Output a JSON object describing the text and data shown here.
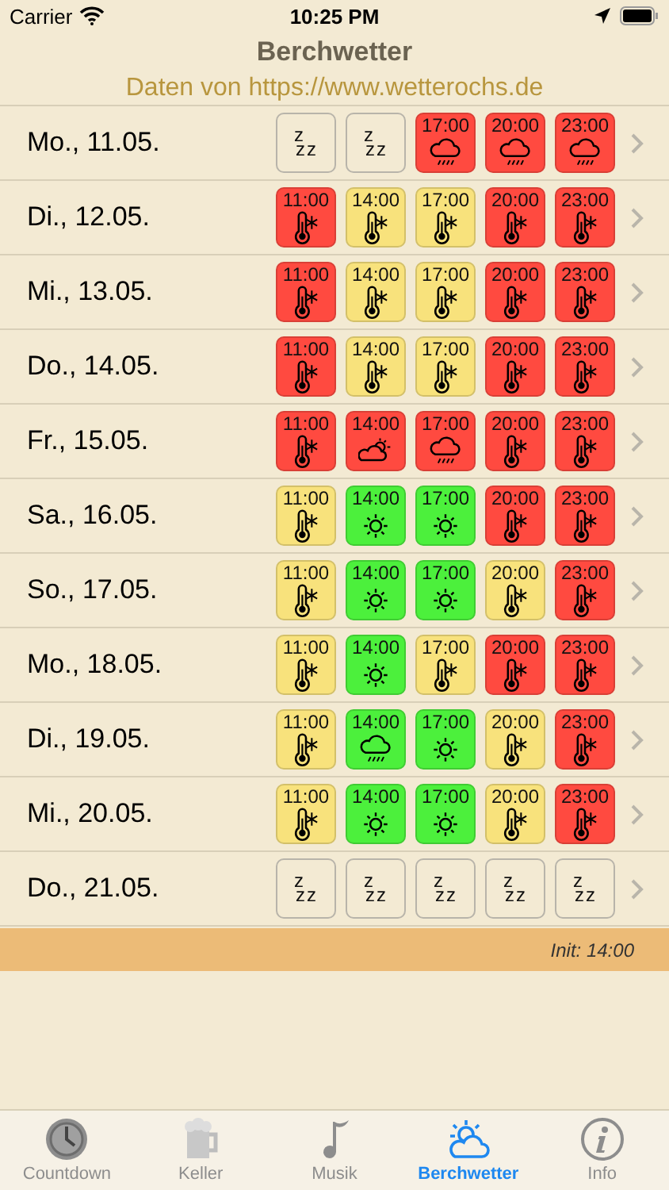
{
  "status_bar": {
    "carrier": "Carrier",
    "time": "10:25 PM"
  },
  "header": {
    "title": "Berchwetter",
    "subtitle": "Daten von https://www.wetterochs.de"
  },
  "days": [
    {
      "label": "Mo., 11.05.",
      "slots": [
        {
          "kind": "sleep",
          "mark": [
            "z",
            "zz"
          ]
        },
        {
          "kind": "sleep",
          "mark": [
            "z",
            "zz"
          ]
        },
        {
          "kind": "rain",
          "time": "17:00",
          "color": "#ff4a40"
        },
        {
          "kind": "rain",
          "time": "20:00",
          "color": "#ff4a40"
        },
        {
          "kind": "rain",
          "time": "23:00",
          "color": "#ff4a40"
        }
      ]
    },
    {
      "label": "Di., 12.05.",
      "slots": [
        {
          "kind": "cold",
          "time": "11:00",
          "color": "#ff4a40"
        },
        {
          "kind": "cold",
          "time": "14:00",
          "color": "#f8e27c"
        },
        {
          "kind": "cold",
          "time": "17:00",
          "color": "#f8e27c"
        },
        {
          "kind": "cold",
          "time": "20:00",
          "color": "#ff4a40"
        },
        {
          "kind": "cold",
          "time": "23:00",
          "color": "#ff4a40"
        }
      ]
    },
    {
      "label": "Mi., 13.05.",
      "slots": [
        {
          "kind": "cold",
          "time": "11:00",
          "color": "#ff4a40"
        },
        {
          "kind": "cold",
          "time": "14:00",
          "color": "#f8e27c"
        },
        {
          "kind": "cold",
          "time": "17:00",
          "color": "#f8e27c"
        },
        {
          "kind": "cold",
          "time": "20:00",
          "color": "#ff4a40"
        },
        {
          "kind": "cold",
          "time": "23:00",
          "color": "#ff4a40"
        }
      ]
    },
    {
      "label": "Do., 14.05.",
      "slots": [
        {
          "kind": "cold",
          "time": "11:00",
          "color": "#ff4a40"
        },
        {
          "kind": "cold",
          "time": "14:00",
          "color": "#f8e27c"
        },
        {
          "kind": "cold",
          "time": "17:00",
          "color": "#f8e27c"
        },
        {
          "kind": "cold",
          "time": "20:00",
          "color": "#ff4a40"
        },
        {
          "kind": "cold",
          "time": "23:00",
          "color": "#ff4a40"
        }
      ]
    },
    {
      "label": "Fr., 15.05.",
      "slots": [
        {
          "kind": "cold",
          "time": "11:00",
          "color": "#ff4a40"
        },
        {
          "kind": "partly",
          "time": "14:00",
          "color": "#ff4a40"
        },
        {
          "kind": "rain",
          "time": "17:00",
          "color": "#ff4a40"
        },
        {
          "kind": "cold",
          "time": "20:00",
          "color": "#ff4a40"
        },
        {
          "kind": "cold",
          "time": "23:00",
          "color": "#ff4a40"
        }
      ]
    },
    {
      "label": "Sa., 16.05.",
      "slots": [
        {
          "kind": "cold",
          "time": "11:00",
          "color": "#f8e27c"
        },
        {
          "kind": "sun",
          "time": "14:00",
          "color": "#4cf03c"
        },
        {
          "kind": "sun",
          "time": "17:00",
          "color": "#4cf03c"
        },
        {
          "kind": "cold",
          "time": "20:00",
          "color": "#ff4a40"
        },
        {
          "kind": "cold",
          "time": "23:00",
          "color": "#ff4a40"
        }
      ]
    },
    {
      "label": "So., 17.05.",
      "slots": [
        {
          "kind": "cold",
          "time": "11:00",
          "color": "#f8e27c"
        },
        {
          "kind": "sun",
          "time": "14:00",
          "color": "#4cf03c"
        },
        {
          "kind": "sun",
          "time": "17:00",
          "color": "#4cf03c"
        },
        {
          "kind": "cold",
          "time": "20:00",
          "color": "#f8e27c"
        },
        {
          "kind": "cold",
          "time": "23:00",
          "color": "#ff4a40"
        }
      ]
    },
    {
      "label": "Mo., 18.05.",
      "slots": [
        {
          "kind": "cold",
          "time": "11:00",
          "color": "#f8e27c"
        },
        {
          "kind": "sun",
          "time": "14:00",
          "color": "#4cf03c"
        },
        {
          "kind": "cold",
          "time": "17:00",
          "color": "#f8e27c"
        },
        {
          "kind": "cold",
          "time": "20:00",
          "color": "#ff4a40"
        },
        {
          "kind": "cold",
          "time": "23:00",
          "color": "#ff4a40"
        }
      ]
    },
    {
      "label": "Di., 19.05.",
      "slots": [
        {
          "kind": "cold",
          "time": "11:00",
          "color": "#f8e27c"
        },
        {
          "kind": "rain",
          "time": "14:00",
          "color": "#4cf03c"
        },
        {
          "kind": "sun",
          "time": "17:00",
          "color": "#4cf03c"
        },
        {
          "kind": "cold",
          "time": "20:00",
          "color": "#f8e27c"
        },
        {
          "kind": "cold",
          "time": "23:00",
          "color": "#ff4a40"
        }
      ]
    },
    {
      "label": "Mi., 20.05.",
      "slots": [
        {
          "kind": "cold",
          "time": "11:00",
          "color": "#f8e27c"
        },
        {
          "kind": "sun",
          "time": "14:00",
          "color": "#4cf03c"
        },
        {
          "kind": "sun",
          "time": "17:00",
          "color": "#4cf03c"
        },
        {
          "kind": "cold",
          "time": "20:00",
          "color": "#f8e27c"
        },
        {
          "kind": "cold",
          "time": "23:00",
          "color": "#ff4a40"
        }
      ]
    },
    {
      "label": "Do., 21.05.",
      "slots": [
        {
          "kind": "sleep",
          "mark": [
            "z",
            "zz"
          ]
        },
        {
          "kind": "sleep",
          "mark": [
            "z",
            "zz"
          ]
        },
        {
          "kind": "sleep",
          "mark": [
            "z",
            "zz"
          ]
        },
        {
          "kind": "sleep",
          "mark": [
            "z",
            "zz"
          ]
        },
        {
          "kind": "sleep",
          "mark": [
            "z",
            "zz"
          ]
        }
      ]
    }
  ],
  "footer": {
    "text": "Init: 14:00"
  },
  "tab_bar": [
    {
      "label": "Countdown",
      "selected": false
    },
    {
      "label": "Keller",
      "selected": false
    },
    {
      "label": "Musik",
      "selected": false
    },
    {
      "label": "Berchwetter",
      "selected": true
    },
    {
      "label": "Info",
      "selected": false
    }
  ]
}
